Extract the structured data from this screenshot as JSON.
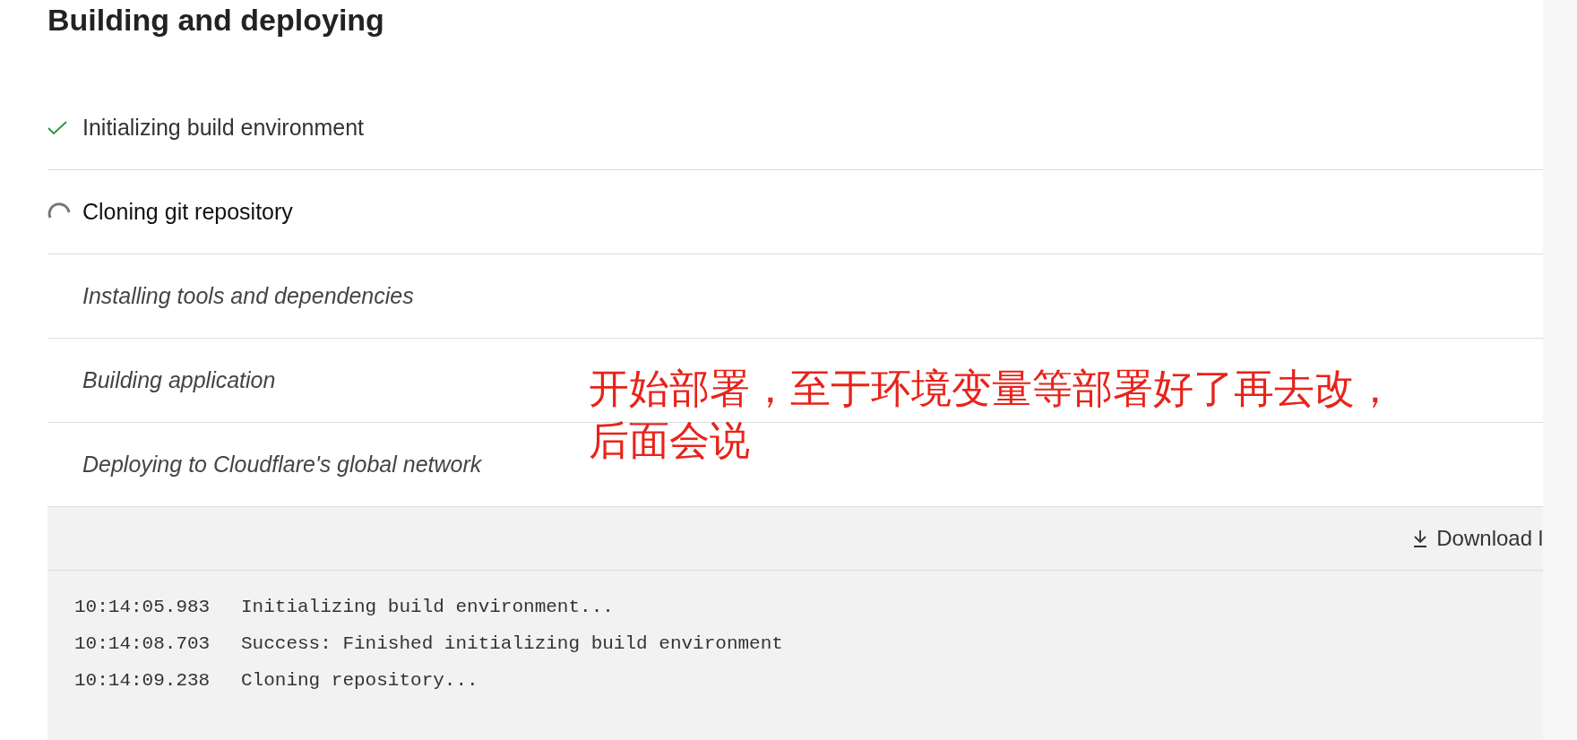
{
  "title": "Building and deploying",
  "steps": [
    {
      "label": "Initializing build environment",
      "kind": "done"
    },
    {
      "label": "Cloning git repository",
      "kind": "running"
    },
    {
      "label": "Installing tools and dependencies",
      "kind": "pending"
    },
    {
      "label": "Building application",
      "kind": "pending"
    },
    {
      "label": "Deploying to Cloudflare's global network",
      "kind": "pending"
    }
  ],
  "log": {
    "download": "Download l",
    "lines": [
      {
        "time": "10:14:05.983",
        "message": "Initializing build environment..."
      },
      {
        "time": "10:14:08.703",
        "message": "Success: Finished initializing build environment"
      },
      {
        "time": "10:14:09.238",
        "message": "Cloning repository..."
      }
    ]
  },
  "annotation": {
    "lines": [
      "开始部署，至于环境变量等部署好了再去改，",
      "后面会说"
    ]
  }
}
